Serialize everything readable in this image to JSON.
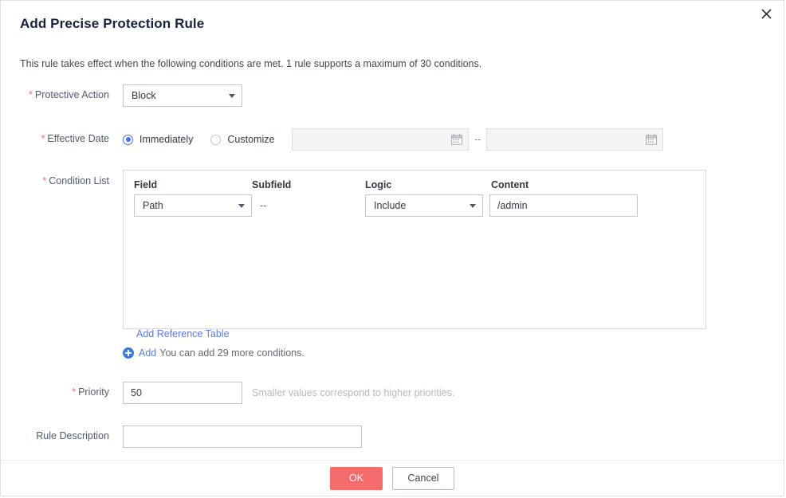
{
  "dialog": {
    "title": "Add Precise Protection Rule",
    "subtitle": "This rule takes effect when the following conditions are met. 1 rule supports a maximum of 30 conditions.",
    "close_icon": "close-icon",
    "required_marker": "*"
  },
  "protective_action": {
    "label": "Protective Action",
    "value": "Block"
  },
  "effective_date": {
    "label": "Effective Date",
    "options": [
      {
        "label": "Immediately",
        "selected": true
      },
      {
        "label": "Customize",
        "selected": false
      }
    ],
    "start_date": "",
    "end_date": "",
    "separator": "--",
    "calendar_icon": "calendar-icon"
  },
  "condition_list": {
    "label": "Condition List",
    "columns": [
      "Field",
      "Subfield",
      "Logic",
      "Content"
    ],
    "rows": [
      {
        "field": "Path",
        "subfield": "--",
        "logic": "Include",
        "content": "/admin"
      }
    ],
    "reference_table_link": "Add Reference Table",
    "add_link": "Add",
    "add_hint": "You can add 29 more conditions.",
    "add_icon": "plus-circle-icon"
  },
  "priority": {
    "label": "Priority",
    "value": "50",
    "hint": "Smaller values correspond to higher priorities."
  },
  "rule_description": {
    "label": "Rule Description",
    "value": "",
    "placeholder": ""
  },
  "footer": {
    "ok_label": "OK",
    "cancel_label": "Cancel"
  },
  "colors": {
    "accent_red": "#f56c6c",
    "link_blue": "#5e7ce0",
    "radio_blue": "#4c6ef5",
    "title": "#17233d"
  }
}
